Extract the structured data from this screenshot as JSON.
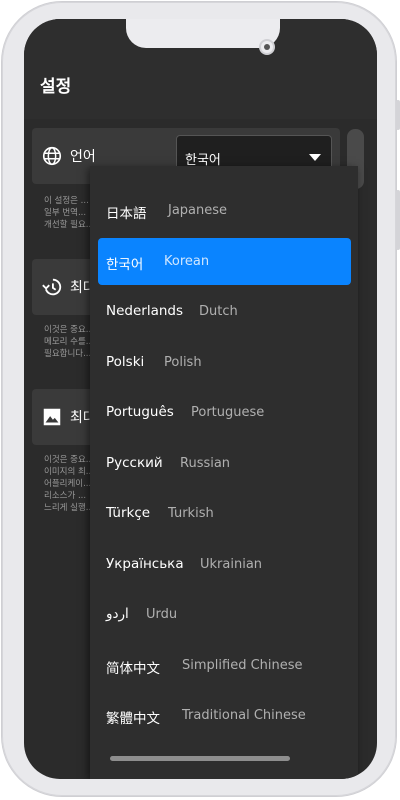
{
  "header": {
    "title": "설정"
  },
  "settings": [
    {
      "label": "언어",
      "icon": "globe-icon",
      "description": "이 설정은 ...\n일부 번역...\n개선할 필요..."
    },
    {
      "label": "최대",
      "icon": "history-icon",
      "description": "이것은 중요...\n메모리 수를...\n필요합니다..."
    },
    {
      "label": "최대",
      "icon": "image-icon",
      "description": "이것은 중요...\n이미지의 최...\n어플리케이...\n리소스가 ...\n느리게 실행..."
    }
  ],
  "language_select": {
    "value": "한국어"
  },
  "languages": [
    {
      "native": "日本語",
      "english": "Japanese",
      "selected": false
    },
    {
      "native": "한국어",
      "english": "Korean",
      "selected": true
    },
    {
      "native": "Nederlands",
      "english": "Dutch",
      "selected": false
    },
    {
      "native": "Polski",
      "english": "Polish",
      "selected": false
    },
    {
      "native": "Português",
      "english": "Portuguese",
      "selected": false
    },
    {
      "native": "Русский",
      "english": "Russian",
      "selected": false
    },
    {
      "native": "Türkçe",
      "english": "Turkish",
      "selected": false
    },
    {
      "native": "Українська",
      "english": "Ukrainian",
      "selected": false
    },
    {
      "native": "اردو",
      "english": "Urdu",
      "selected": false
    },
    {
      "native": "简体中文",
      "english": "Simplified Chinese",
      "selected": false
    },
    {
      "native": "繁體中文",
      "english": "Traditional Chinese",
      "selected": false
    }
  ],
  "colors": {
    "accent": "#0a84ff",
    "background": "#2b2b2b",
    "card": "#3a3a3a"
  }
}
